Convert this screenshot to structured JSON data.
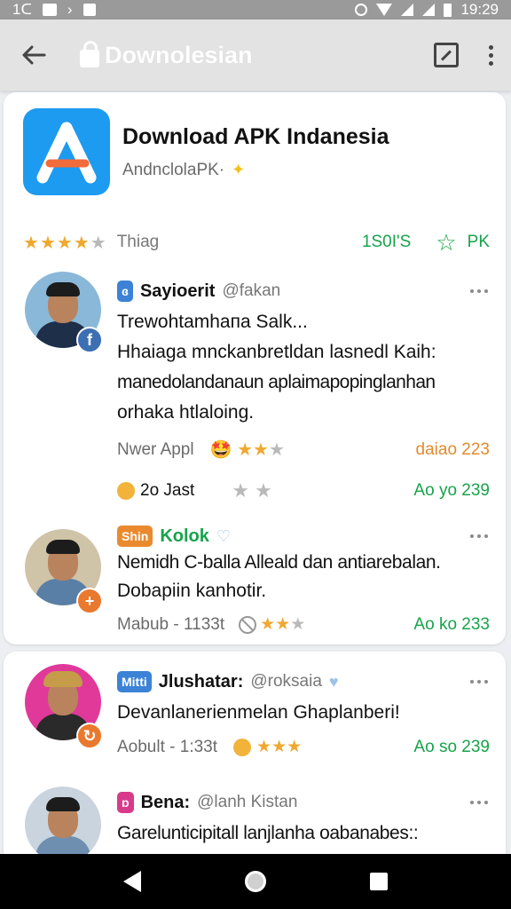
{
  "status_bar": {
    "time_left": "1ᑕ",
    "time": "19:29"
  },
  "app_bar": {
    "title": "Downolesian"
  },
  "app": {
    "name": "Download APK Indanesia",
    "subtitle": "AndnclolaPK·",
    "rating_label": "Thiag",
    "rating_count": "1S0I'S",
    "rating_k": "PK",
    "stars_filled": 4,
    "stars_total": 5
  },
  "posts": [
    {
      "tag": "ɞ",
      "username": "Sayioerit",
      "handle": "@fakan",
      "text_lines": [
        "Trewohtamhaпa Salk...",
        "Hhaiaga mnckanbretldan lasnedl Kaih:",
        "manedolandanaun aplaimapopinglanhan",
        "orhaka htlaloing."
      ],
      "meta_left": "Nwer Appl",
      "meta_right": "daiao 223",
      "footer_left": "2o Jast",
      "footer_right": "Ao yo 239"
    },
    {
      "tag": "Shin",
      "username": "Kolok",
      "text_lines": [
        "Nemidh C-balla Alleald dan antiarebalan.",
        "Dobapiin kanhotir."
      ],
      "meta_left": "Mabub - 1133t",
      "meta_right": "Ao ko 233"
    },
    {
      "tag": "Mitti",
      "username": "Jlushatar:",
      "handle": "@roksaia",
      "text_lines": [
        "Devanlanerienmelan Ghaplanberi!"
      ],
      "meta_left": "Aobult - 1:33t",
      "meta_right": "Ao so 239"
    },
    {
      "tag": "ɒ",
      "username": "Bena:",
      "handle": "@lanh Kistan",
      "text_lines": [
        "Garelunticipitall lanjlanha oabanabes::"
      ]
    }
  ]
}
